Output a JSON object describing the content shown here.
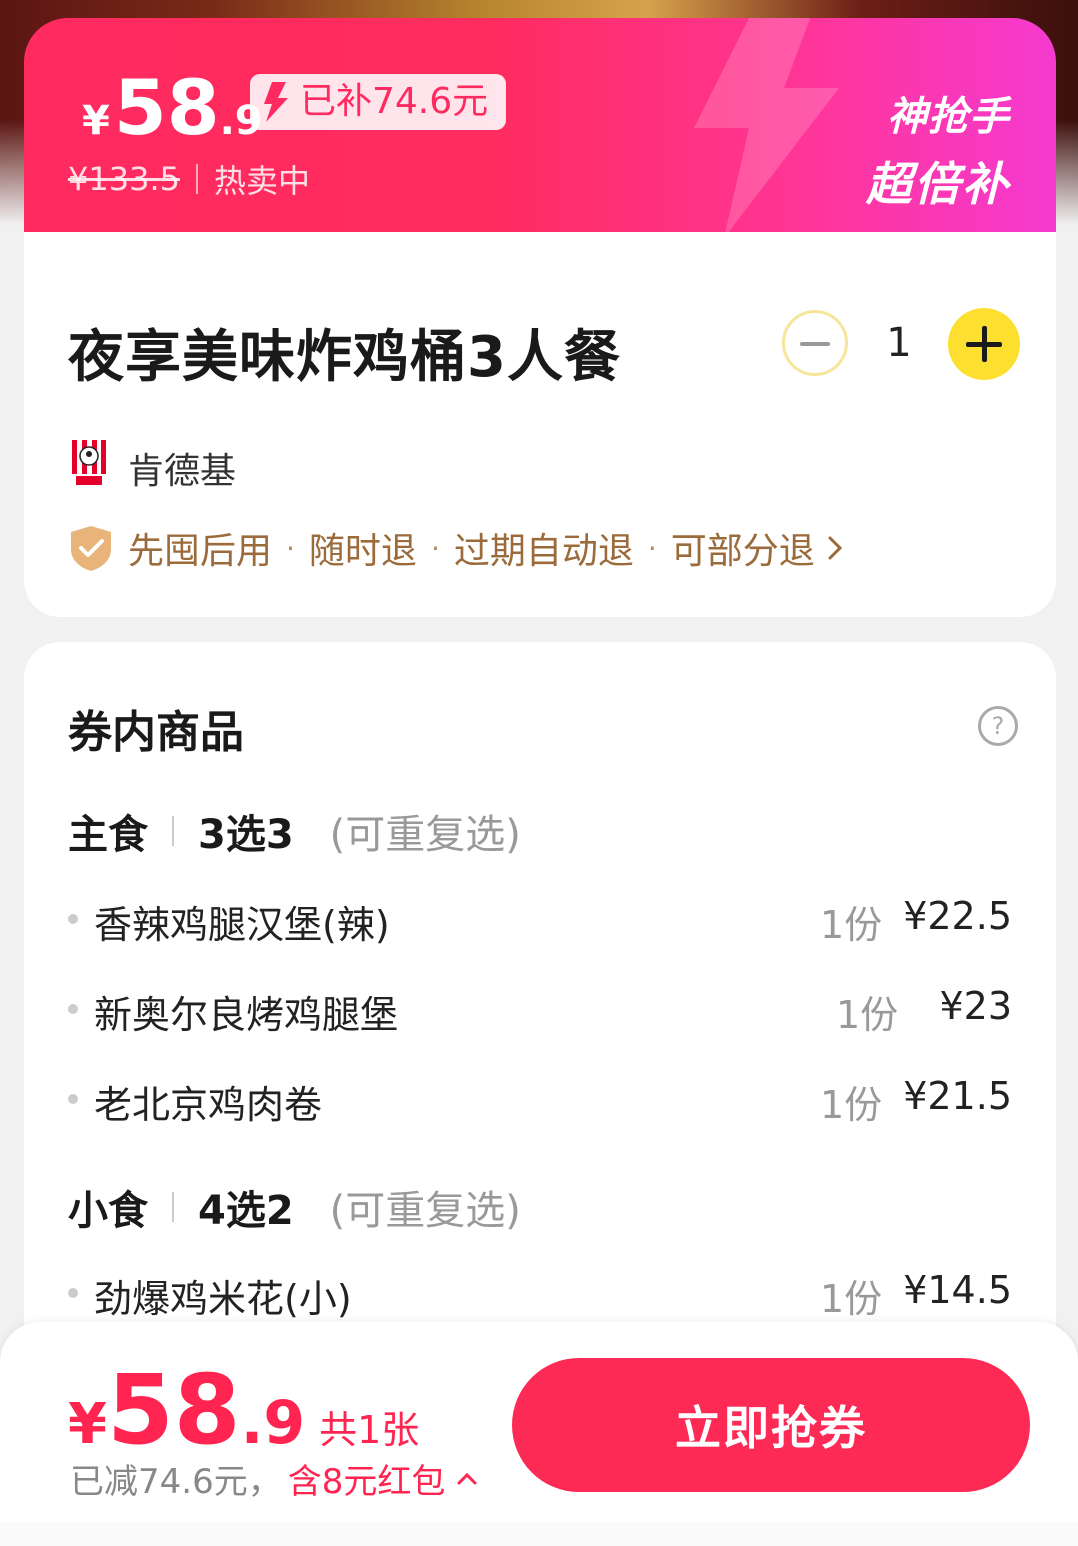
{
  "header": {
    "price_symbol": "¥",
    "price_int": "58",
    "price_dec": ".9",
    "subsidy_badge": "已补74.6元",
    "original_price": "¥133.5",
    "status": "热卖中",
    "slogan_line1": "神抢手",
    "slogan_line2": "超倍补"
  },
  "product": {
    "title": "夜享美味炸鸡桶3人餐",
    "quantity": "1",
    "brand": "肯德基",
    "guarantees": [
      "先囤后用",
      "随时退",
      "过期自动退",
      "可部分退"
    ],
    "dot": "·"
  },
  "items_section": {
    "title": "券内商品",
    "help_glyph": "?",
    "groups": [
      {
        "name": "主食",
        "rule": "3选3",
        "note": "(可重复选)",
        "items": [
          {
            "name": "香辣鸡腿汉堡(辣)",
            "qty": "1份",
            "price": "¥22.5"
          },
          {
            "name": "新奥尔良烤鸡腿堡",
            "qty": "1份",
            "price": "¥23"
          },
          {
            "name": "老北京鸡肉卷",
            "qty": "1份",
            "price": "¥21.5"
          }
        ]
      },
      {
        "name": "小食",
        "rule": "4选2",
        "note": "(可重复选)",
        "items": [
          {
            "name": "劲爆鸡米花(小)",
            "qty": "1份",
            "price": "¥14.5"
          }
        ]
      }
    ]
  },
  "bottom_bar": {
    "price_symbol": "¥",
    "price_int": "58",
    "price_dec": ".9",
    "count": "共1张",
    "saved": "已减74.6元，",
    "redpack": "含8元红包",
    "buy_label": "立即抢券"
  },
  "colors": {
    "brand_red": "#ff2550",
    "banner_pink": "#f53ad0",
    "plus_yellow": "#fde02f",
    "guarantee_brown": "#9b6b3c"
  },
  "icons": {
    "qty_minus": "minus-circle-icon",
    "qty_plus": "plus-circle-icon",
    "brand_logo": "kfc-logo",
    "guarantee": "shield-check-icon",
    "chevron": "chevron-right-icon",
    "help": "question-circle-icon",
    "caret": "caret-up-icon"
  }
}
